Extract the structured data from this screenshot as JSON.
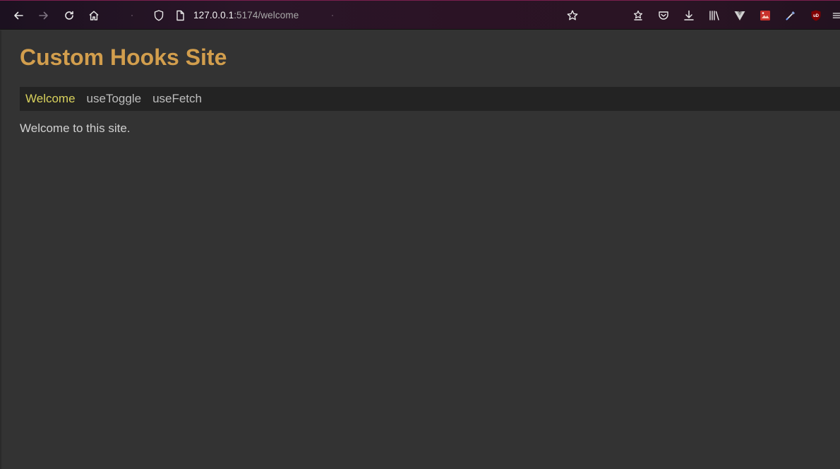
{
  "browser": {
    "url_host": "127.0.0.1",
    "url_rest": ":5174/welcome",
    "icons": {
      "back": "back-arrow-icon",
      "forward": "forward-arrow-icon",
      "reload": "reload-icon",
      "home": "home-icon",
      "bookmark_star": "bookmark-star-icon",
      "pocket": "pocket-icon",
      "downloads": "download-icon",
      "library": "library-icon",
      "menu": "hamburger-menu-icon"
    }
  },
  "site": {
    "title": "Custom Hooks Site",
    "nav": [
      {
        "label": "Welcome",
        "active": true
      },
      {
        "label": "useToggle",
        "active": false
      },
      {
        "label": "useFetch",
        "active": false
      }
    ],
    "body_text": "Welcome to this site."
  },
  "colors": {
    "title": "#d29e4d",
    "nav_active": "#d8d15c",
    "nav_inactive": "#bdbdbd",
    "page_bg": "#333333",
    "nav_bg": "#232323"
  }
}
